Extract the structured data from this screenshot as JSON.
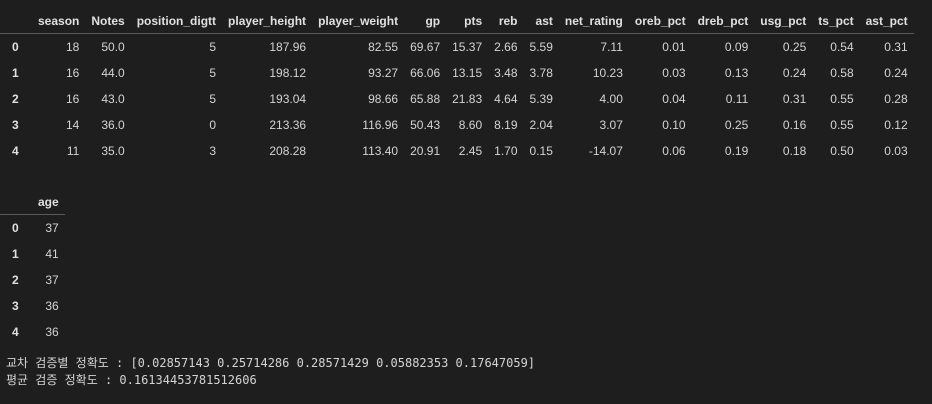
{
  "main_table": {
    "columns": [
      "",
      "season",
      "Notes",
      "position_digtt",
      "player_height",
      "player_weight",
      "gp",
      "pts",
      "reb",
      "ast",
      "net_rating",
      "oreb_pct",
      "dreb_pct",
      "usg_pct",
      "ts_pct",
      "ast_pct"
    ],
    "rows": [
      [
        "0",
        "18",
        "50.0",
        "5",
        "187.96",
        "82.55",
        "69.67",
        "15.37",
        "2.66",
        "5.59",
        "7.11",
        "0.01",
        "0.09",
        "0.25",
        "0.54",
        "0.31"
      ],
      [
        "1",
        "16",
        "44.0",
        "5",
        "198.12",
        "93.27",
        "66.06",
        "13.15",
        "3.48",
        "3.78",
        "10.23",
        "0.03",
        "0.13",
        "0.24",
        "0.58",
        "0.24"
      ],
      [
        "2",
        "16",
        "43.0",
        "5",
        "193.04",
        "98.66",
        "65.88",
        "21.83",
        "4.64",
        "5.39",
        "4.00",
        "0.04",
        "0.11",
        "0.31",
        "0.55",
        "0.28"
      ],
      [
        "3",
        "14",
        "36.0",
        "0",
        "213.36",
        "116.96",
        "50.43",
        "8.60",
        "8.19",
        "2.04",
        "3.07",
        "0.10",
        "0.25",
        "0.16",
        "0.55",
        "0.12"
      ],
      [
        "4",
        "11",
        "35.0",
        "3",
        "208.28",
        "113.40",
        "20.91",
        "2.45",
        "1.70",
        "0.15",
        "-14.07",
        "0.06",
        "0.19",
        "0.18",
        "0.50",
        "0.03"
      ]
    ]
  },
  "age_table": {
    "columns": [
      "",
      "age"
    ],
    "rows": [
      [
        "0",
        "37"
      ],
      [
        "1",
        "41"
      ],
      [
        "2",
        "37"
      ],
      [
        "3",
        "36"
      ],
      [
        "4",
        "36"
      ]
    ]
  },
  "output": {
    "line1": "교차 검증별 정확도 : [0.02857143 0.25714286 0.28571429 0.05882353 0.17647059]",
    "line2": "평균 검증 정확도 : 0.16134453781512606"
  }
}
